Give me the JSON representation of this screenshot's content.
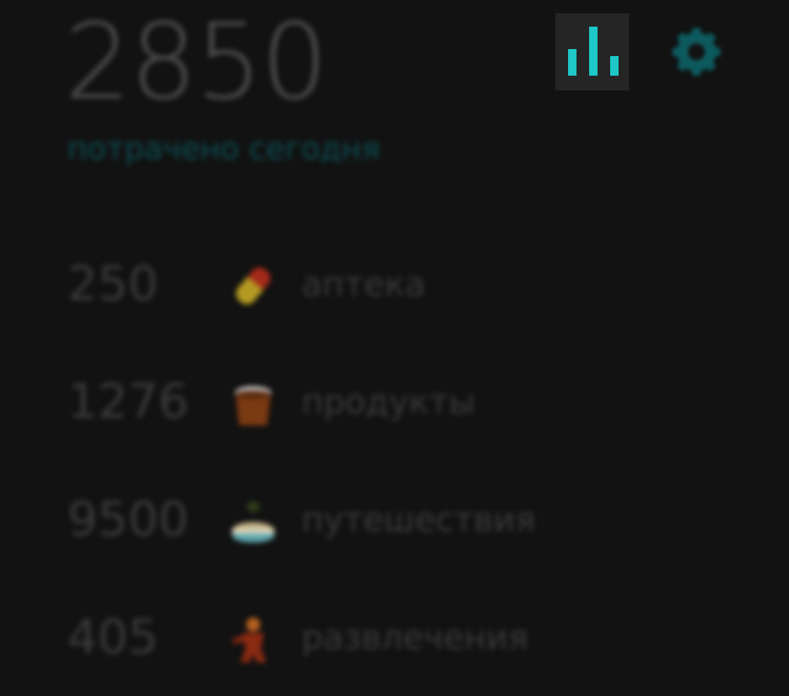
{
  "header": {
    "total": "2850",
    "subtitle": "потрачено сегодня"
  },
  "toolbar": {
    "stats_icon": "bar-chart-icon",
    "settings_icon": "gear-icon",
    "accent_color": "#1ec8c8"
  },
  "expenses": [
    {
      "amount": "250",
      "icon": "pill-icon",
      "label": "аптека"
    },
    {
      "amount": "1276",
      "icon": "grocery-bag-icon",
      "label": "продукты"
    },
    {
      "amount": "9500",
      "icon": "travel-icon",
      "label": "путешествия"
    },
    {
      "amount": "405",
      "icon": "entertainment-icon",
      "label": "развлечения"
    }
  ]
}
